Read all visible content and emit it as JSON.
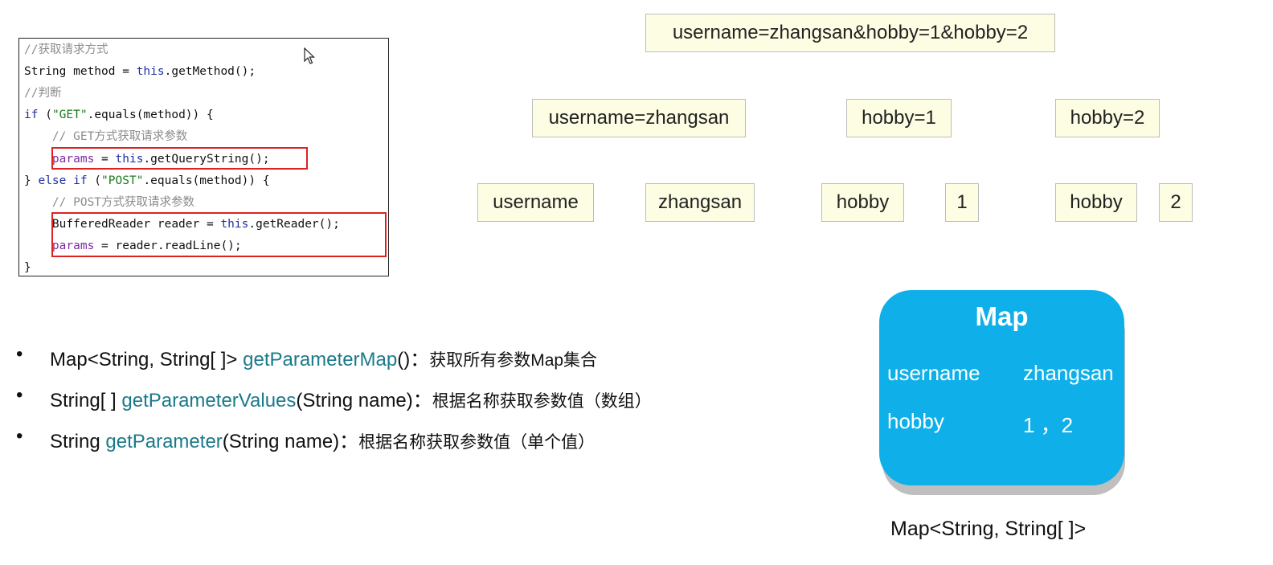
{
  "code": {
    "lines": [
      "//获取请求方式",
      "String method = this.getMethod();",
      "//判断",
      "if (\"GET\".equals(method)) {",
      "    // GET方式获取请求参数",
      "    params = this.getQueryString();",
      "} else if (\"POST\".equals(method)) {",
      "    // POST方式获取请求参数",
      "    BufferedReader reader = this.getReader();",
      "    params = reader.readLine();",
      "}"
    ]
  },
  "query": {
    "full": "username=zhangsan&hobby=1&hobby=2",
    "pairs": [
      "username=zhangsan",
      "hobby=1",
      "hobby=2"
    ],
    "parts": [
      "username",
      "zhangsan",
      "hobby",
      "1",
      "hobby",
      "2"
    ]
  },
  "methods": [
    {
      "prefix": "Map<String, String[ ]> ",
      "name": "getParameterMap",
      "suffix": "()：",
      "desc": "获取所有参数Map集合"
    },
    {
      "prefix": "String[ ] ",
      "name": "getParameterValues",
      "suffix": "(String name)：",
      "desc": "根据名称获取参数值（数组）"
    },
    {
      "prefix": "String ",
      "name": "getParameter",
      "suffix": "(String name)：",
      "desc": "根据名称获取参数值（单个值）"
    }
  ],
  "bullet_symbol": "•",
  "map": {
    "title": "Map",
    "rows": [
      {
        "key": "username",
        "value": "zhangsan"
      },
      {
        "key": "hobby",
        "value": "1 ，2"
      }
    ],
    "caption": "Map<String, String[ ]>"
  },
  "colors": {
    "map_bg": "#0fb0e9",
    "box_bg": "#fdfde3",
    "method_name": "#1a7a8a",
    "highlight": "#dd2222"
  }
}
